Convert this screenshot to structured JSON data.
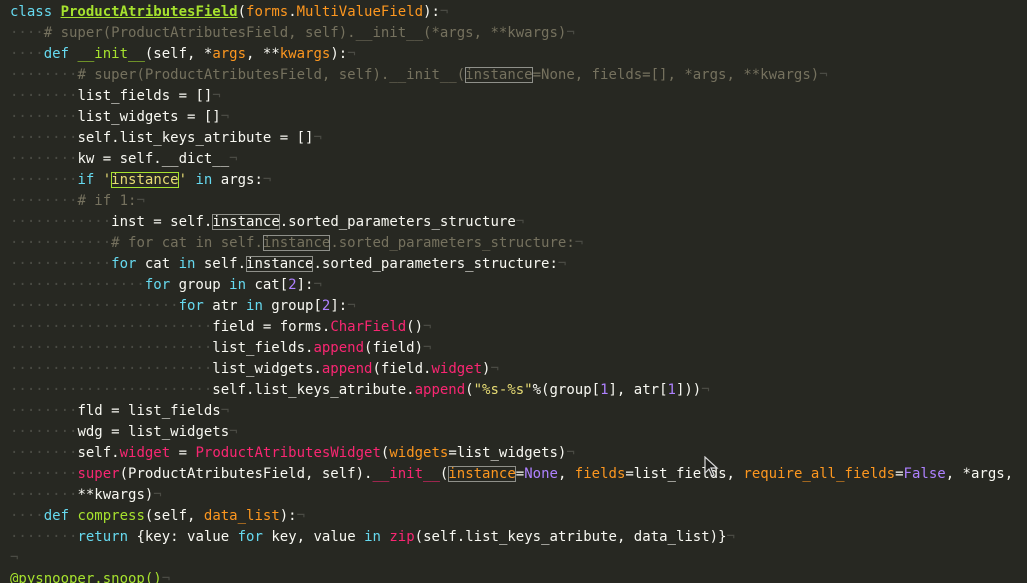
{
  "editor": {
    "lines": [
      {
        "indent": "",
        "segs": [
          [
            "kw",
            "class "
          ],
          [
            "cls",
            "ProductAtributesField"
          ],
          [
            "plain",
            "("
          ],
          [
            "base",
            "forms"
          ],
          [
            "plain",
            "."
          ],
          [
            "base",
            "MultiValueField"
          ],
          [
            "plain",
            "):"
          ],
          [
            "eol",
            "¬"
          ]
        ]
      },
      {
        "indent": "····",
        "segs": [
          [
            "cm",
            "# super(ProductAtributesField, self).__init__(*args, **kwargs)"
          ],
          [
            "eol",
            "¬"
          ]
        ]
      },
      {
        "indent": "····",
        "segs": [
          [
            "kw",
            "def "
          ],
          [
            "fn",
            "__init__"
          ],
          [
            "plain",
            "(self, *"
          ],
          [
            "arg",
            "args"
          ],
          [
            "plain",
            ", **"
          ],
          [
            "arg",
            "kwargs"
          ],
          [
            "plain",
            "):"
          ],
          [
            "eol",
            "¬"
          ]
        ]
      },
      {
        "indent": "········",
        "segs": [
          [
            "cm",
            "# super(ProductAtributesField, self).__init__("
          ],
          [
            "cm box",
            "instance"
          ],
          [
            "cm",
            "=None, fields=[], *args, **kwargs)"
          ],
          [
            "eol",
            "¬"
          ]
        ]
      },
      {
        "indent": "········",
        "segs": [
          [
            "plain",
            "list_fields = []"
          ],
          [
            "eol",
            "¬"
          ]
        ]
      },
      {
        "indent": "········",
        "segs": [
          [
            "plain",
            "list_widgets = []"
          ],
          [
            "eol",
            "¬"
          ]
        ]
      },
      {
        "indent": "········",
        "segs": [
          [
            "plain",
            "self.list_keys_atribute = []"
          ],
          [
            "eol",
            "¬"
          ]
        ]
      },
      {
        "indent": "········",
        "segs": [
          [
            "plain",
            "kw = self.__dict__"
          ],
          [
            "eol",
            "¬"
          ]
        ]
      },
      {
        "indent": "········",
        "segs": [
          [
            "kw",
            "if "
          ],
          [
            "str",
            "'"
          ],
          [
            "str box-green",
            "instance"
          ],
          [
            "str",
            "'"
          ],
          [
            "plain",
            " "
          ],
          [
            "kw",
            "in"
          ],
          [
            "plain",
            " args:"
          ],
          [
            "eol",
            "¬"
          ]
        ]
      },
      {
        "indent": "········",
        "segs": [
          [
            "cm",
            "# if 1:"
          ],
          [
            "eol",
            "¬"
          ]
        ]
      },
      {
        "indent": "············",
        "segs": [
          [
            "plain",
            "inst = self."
          ],
          [
            "plain box",
            "instance"
          ],
          [
            "plain",
            ".sorted_parameters_structure"
          ],
          [
            "eol",
            "¬"
          ]
        ]
      },
      {
        "indent": "············",
        "segs": [
          [
            "cm",
            "# for cat in self."
          ],
          [
            "cm box",
            "instance"
          ],
          [
            "cm",
            ".sorted_parameters_structure:"
          ],
          [
            "eol",
            "¬"
          ]
        ]
      },
      {
        "indent": "············",
        "segs": [
          [
            "kw",
            "for "
          ],
          [
            "plain",
            "cat "
          ],
          [
            "kw",
            "in"
          ],
          [
            "plain",
            " self."
          ],
          [
            "plain box",
            "instance"
          ],
          [
            "plain",
            ".sorted_parameters_structure:"
          ],
          [
            "eol",
            "¬"
          ]
        ]
      },
      {
        "indent": "················",
        "segs": [
          [
            "kw",
            "for "
          ],
          [
            "plain",
            "group "
          ],
          [
            "kw",
            "in"
          ],
          [
            "plain",
            " cat["
          ],
          [
            "num",
            "2"
          ],
          [
            "plain",
            "]:"
          ],
          [
            "eol",
            "¬"
          ]
        ]
      },
      {
        "indent": "····················",
        "segs": [
          [
            "kw",
            "for "
          ],
          [
            "plain",
            "atr "
          ],
          [
            "kw",
            "in"
          ],
          [
            "plain",
            " group["
          ],
          [
            "num",
            "2"
          ],
          [
            "plain",
            "]:"
          ],
          [
            "eol",
            "¬"
          ]
        ]
      },
      {
        "indent": "························",
        "segs": [
          [
            "plain",
            "field = forms."
          ],
          [
            "mag",
            "CharField"
          ],
          [
            "plain",
            "()"
          ],
          [
            "eol",
            "¬"
          ]
        ]
      },
      {
        "indent": "························",
        "segs": [
          [
            "plain",
            "list_fields."
          ],
          [
            "mag",
            "append"
          ],
          [
            "plain",
            "(field)"
          ],
          [
            "eol",
            "¬"
          ]
        ]
      },
      {
        "indent": "························",
        "segs": [
          [
            "plain",
            "list_widgets."
          ],
          [
            "mag",
            "append"
          ],
          [
            "plain",
            "(field."
          ],
          [
            "mag",
            "widget"
          ],
          [
            "plain",
            ")"
          ],
          [
            "eol",
            "¬"
          ]
        ]
      },
      {
        "indent": "························",
        "segs": [
          [
            "plain",
            "self.list_keys_atribute."
          ],
          [
            "mag",
            "append"
          ],
          [
            "plain",
            "("
          ],
          [
            "str",
            "\"%s-%s\""
          ],
          [
            "plain",
            "%(group["
          ],
          [
            "num",
            "1"
          ],
          [
            "plain",
            "], atr["
          ],
          [
            "num",
            "1"
          ],
          [
            "plain",
            "]))"
          ],
          [
            "eol",
            "¬"
          ]
        ]
      },
      {
        "indent": "········",
        "segs": [
          [
            "plain",
            "fld = list_fields"
          ],
          [
            "eol",
            "¬"
          ]
        ]
      },
      {
        "indent": "········",
        "segs": [
          [
            "plain",
            "wdg = list_widgets"
          ],
          [
            "eol",
            "¬"
          ]
        ]
      },
      {
        "indent": "········",
        "segs": [
          [
            "plain",
            "self."
          ],
          [
            "mag",
            "widget"
          ],
          [
            "plain",
            " = "
          ],
          [
            "mag",
            "ProductAtributesWidget"
          ],
          [
            "plain",
            "("
          ],
          [
            "arg",
            "widgets"
          ],
          [
            "plain",
            "=list_widgets)"
          ],
          [
            "eol",
            "¬"
          ]
        ]
      },
      {
        "indent": "········",
        "segs": [
          [
            "mag",
            "super"
          ],
          [
            "plain",
            "(ProductAtributesField, self)."
          ],
          [
            "mag",
            "__init__"
          ],
          [
            "plain",
            "("
          ],
          [
            "arg box",
            "instance"
          ],
          [
            "plain",
            "="
          ],
          [
            "cst",
            "None"
          ],
          [
            "plain",
            ", "
          ],
          [
            "arg",
            "fields"
          ],
          [
            "plain",
            "=list_fields, "
          ],
          [
            "arg",
            "require_all_fields"
          ],
          [
            "plain",
            "="
          ],
          [
            "cst",
            "False"
          ],
          [
            "plain",
            ", *args,"
          ]
        ]
      },
      {
        "indent": "········",
        "segs": [
          [
            "plain",
            "**kwargs)"
          ],
          [
            "eol",
            "¬"
          ]
        ]
      },
      {
        "indent": "····",
        "segs": [
          [
            "kw",
            "def "
          ],
          [
            "fn",
            "compress"
          ],
          [
            "plain",
            "(self, "
          ],
          [
            "arg",
            "data_list"
          ],
          [
            "plain",
            "):"
          ],
          [
            "eol",
            "¬"
          ]
        ]
      },
      {
        "indent": "········",
        "segs": [
          [
            "kw",
            "return "
          ],
          [
            "plain",
            "{key: value "
          ],
          [
            "kw",
            "for"
          ],
          [
            "plain",
            " key, value "
          ],
          [
            "kw",
            "in"
          ],
          [
            "plain",
            " "
          ],
          [
            "mag",
            "zip"
          ],
          [
            "plain",
            "(self.list_keys_atribute, data_list)}"
          ],
          [
            "eol",
            "¬"
          ]
        ]
      },
      {
        "indent": "",
        "segs": [
          [
            "eol",
            "¬"
          ]
        ]
      },
      {
        "indent": "",
        "segs": [
          [
            "fn",
            "@pysnooper.snoop()"
          ],
          [
            "eol",
            "¬"
          ]
        ]
      }
    ]
  },
  "colors": {
    "background": "#272822",
    "keyword": "#66d9ef",
    "class_name": "#a6e22e",
    "comment": "#75715e",
    "string": "#e6db74",
    "number": "#ae81ff",
    "builtin": "#f92672"
  },
  "icons": {
    "mouse_cursor": "mouse-pointer-icon"
  }
}
